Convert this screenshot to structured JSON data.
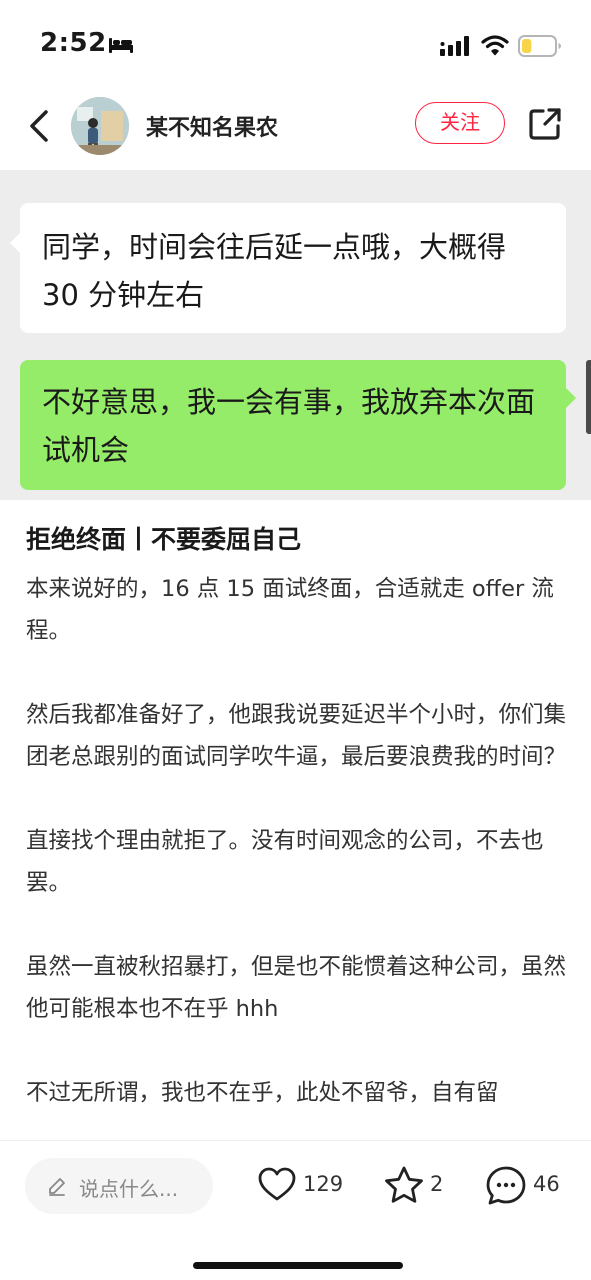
{
  "status_bar": {
    "time": "2:52",
    "icons": [
      "bed-icon",
      "signal-icon",
      "wifi-icon",
      "battery-icon"
    ],
    "battery_level": 0.3,
    "battery_color": "#f7d449"
  },
  "header": {
    "username": "某不知名果农",
    "follow_label": "关注",
    "icons": [
      "back-arrow-icon",
      "share-icon"
    ],
    "accent_color": "#ff2442"
  },
  "chat": {
    "messages": [
      {
        "side": "left",
        "text": "同学，时间会往后延一点哦，大概得 30 分钟左右"
      },
      {
        "side": "right",
        "text": "不好意思，我一会有事，我放弃本次面试机会"
      }
    ],
    "bubble_colors": {
      "left": "#ffffff",
      "right": "#95ec69",
      "background": "#ededed"
    }
  },
  "post": {
    "title": "拒绝终面丨不要委屈自己",
    "paragraphs": [
      "本来说好的，16 点 15 面试终面，合适就走 offer 流程。",
      "然后我都准备好了，他跟我说要延迟半个小时，你们集团老总跟别的面试同学吹牛逼，最后要浪费我的时间？",
      "直接找个理由就拒了。没有时间观念的公司，不去也罢。",
      "虽然一直被秋招暴打，但是也不能惯着这种公司，虽然他可能根本也不在乎 hhh",
      "不过无所谓，我也不在乎，此处不留爷，自有留"
    ]
  },
  "bottom_bar": {
    "comment_placeholder": "说点什么...",
    "likes": "129",
    "collects": "2",
    "comments": "46",
    "icons": [
      "pen-icon",
      "heart-icon",
      "star-icon",
      "comment-bubble-icon"
    ]
  }
}
